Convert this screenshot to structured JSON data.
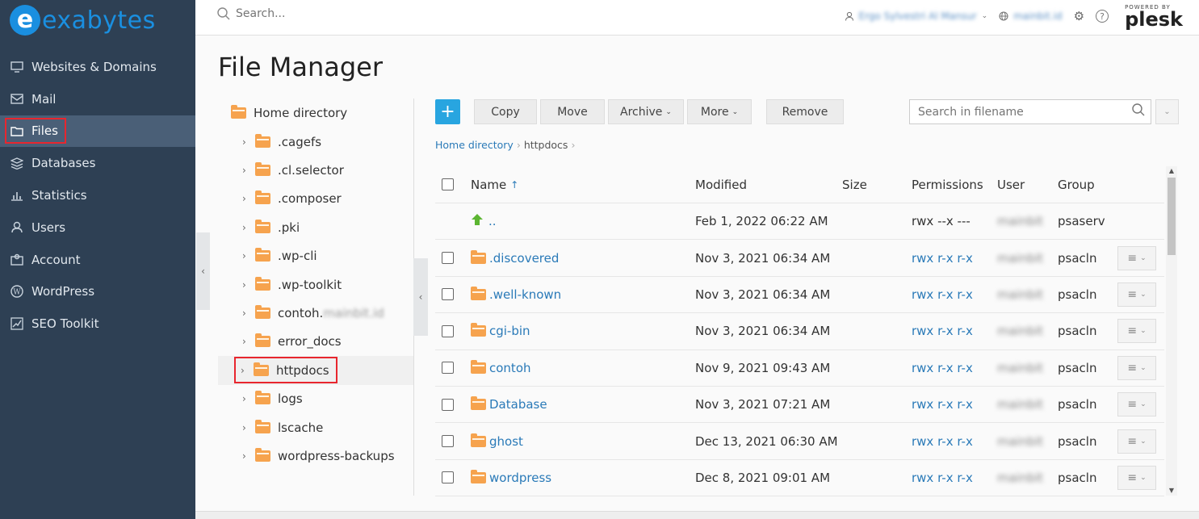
{
  "brand": {
    "logo_letter": "e",
    "logo_text": "exabytes",
    "powered_by": "POWERED BY",
    "plesk": "plesk"
  },
  "sidebar": {
    "items": [
      {
        "label": "Websites & Domains",
        "icon": "monitor-icon"
      },
      {
        "label": "Mail",
        "icon": "envelope-icon"
      },
      {
        "label": "Files",
        "icon": "folder-icon",
        "active": true
      },
      {
        "label": "Databases",
        "icon": "database-icon"
      },
      {
        "label": "Statistics",
        "icon": "bar-chart-icon"
      },
      {
        "label": "Users",
        "icon": "user-icon"
      },
      {
        "label": "Account",
        "icon": "account-icon"
      },
      {
        "label": "WordPress",
        "icon": "wordpress-icon"
      },
      {
        "label": "SEO Toolkit",
        "icon": "seo-chart-icon"
      }
    ]
  },
  "header": {
    "search_placeholder": "Search...",
    "user_name": "Ergo Sylvestri Al Mansur",
    "subscription": "mainbit.id"
  },
  "page": {
    "title": "File Manager"
  },
  "tree": {
    "root": "Home directory",
    "items": [
      {
        "label": ".cagefs"
      },
      {
        "label": ".cl.selector"
      },
      {
        "label": ".composer"
      },
      {
        "label": ".pki"
      },
      {
        "label": ".wp-cli"
      },
      {
        "label": ".wp-toolkit"
      },
      {
        "label": "contoh.",
        "suffix": "mainbit.id"
      },
      {
        "label": "error_docs"
      },
      {
        "label": "httpdocs",
        "selected": true
      },
      {
        "label": "logs"
      },
      {
        "label": "lscache"
      },
      {
        "label": "wordpress-backups"
      }
    ]
  },
  "toolbar": {
    "add": "+",
    "copy": "Copy",
    "move": "Move",
    "archive": "Archive",
    "more": "More",
    "remove": "Remove",
    "filename_search_placeholder": "Search in filename"
  },
  "breadcrumb": {
    "home": "Home directory",
    "current": "httpdocs"
  },
  "table": {
    "headers": {
      "name": "Name",
      "sort_arrow": "↑",
      "modified": "Modified",
      "size": "Size",
      "permissions": "Permissions",
      "user": "User",
      "group": "Group"
    },
    "rows": [
      {
        "name": "..",
        "modified": "Feb 1, 2022 06:22 AM",
        "permissions": "rwx --x ---",
        "user": "mainbit",
        "group": "psaserv",
        "parent": true
      },
      {
        "name": ".discovered",
        "modified": "Nov 3, 2021 06:34 AM",
        "permissions": "rwx r-x r-x",
        "user": "mainbit",
        "group": "psacln"
      },
      {
        "name": ".well-known",
        "modified": "Nov 3, 2021 06:34 AM",
        "permissions": "rwx r-x r-x",
        "user": "mainbit",
        "group": "psacln"
      },
      {
        "name": "cgi-bin",
        "modified": "Nov 3, 2021 06:34 AM",
        "permissions": "rwx r-x r-x",
        "user": "mainbit",
        "group": "psacln"
      },
      {
        "name": "contoh",
        "modified": "Nov 9, 2021 09:43 AM",
        "permissions": "rwx r-x r-x",
        "user": "mainbit",
        "group": "psacln"
      },
      {
        "name": "Database",
        "modified": "Nov 3, 2021 07:21 AM",
        "permissions": "rwx r-x r-x",
        "user": "mainbit",
        "group": "psacln"
      },
      {
        "name": "ghost",
        "modified": "Dec 13, 2021 06:30 AM",
        "permissions": "rwx r-x r-x",
        "user": "mainbit",
        "group": "psacln"
      },
      {
        "name": "wordpress",
        "modified": "Dec 8, 2021 09:01 AM",
        "permissions": "rwx r-x r-x",
        "user": "mainbit",
        "group": "psacln"
      }
    ]
  },
  "colors": {
    "sidebar": "#2e4054",
    "accent": "#28a5e0",
    "highlight": "#e8262e",
    "folder": "#f6a34e",
    "link": "#2a7ab8"
  }
}
